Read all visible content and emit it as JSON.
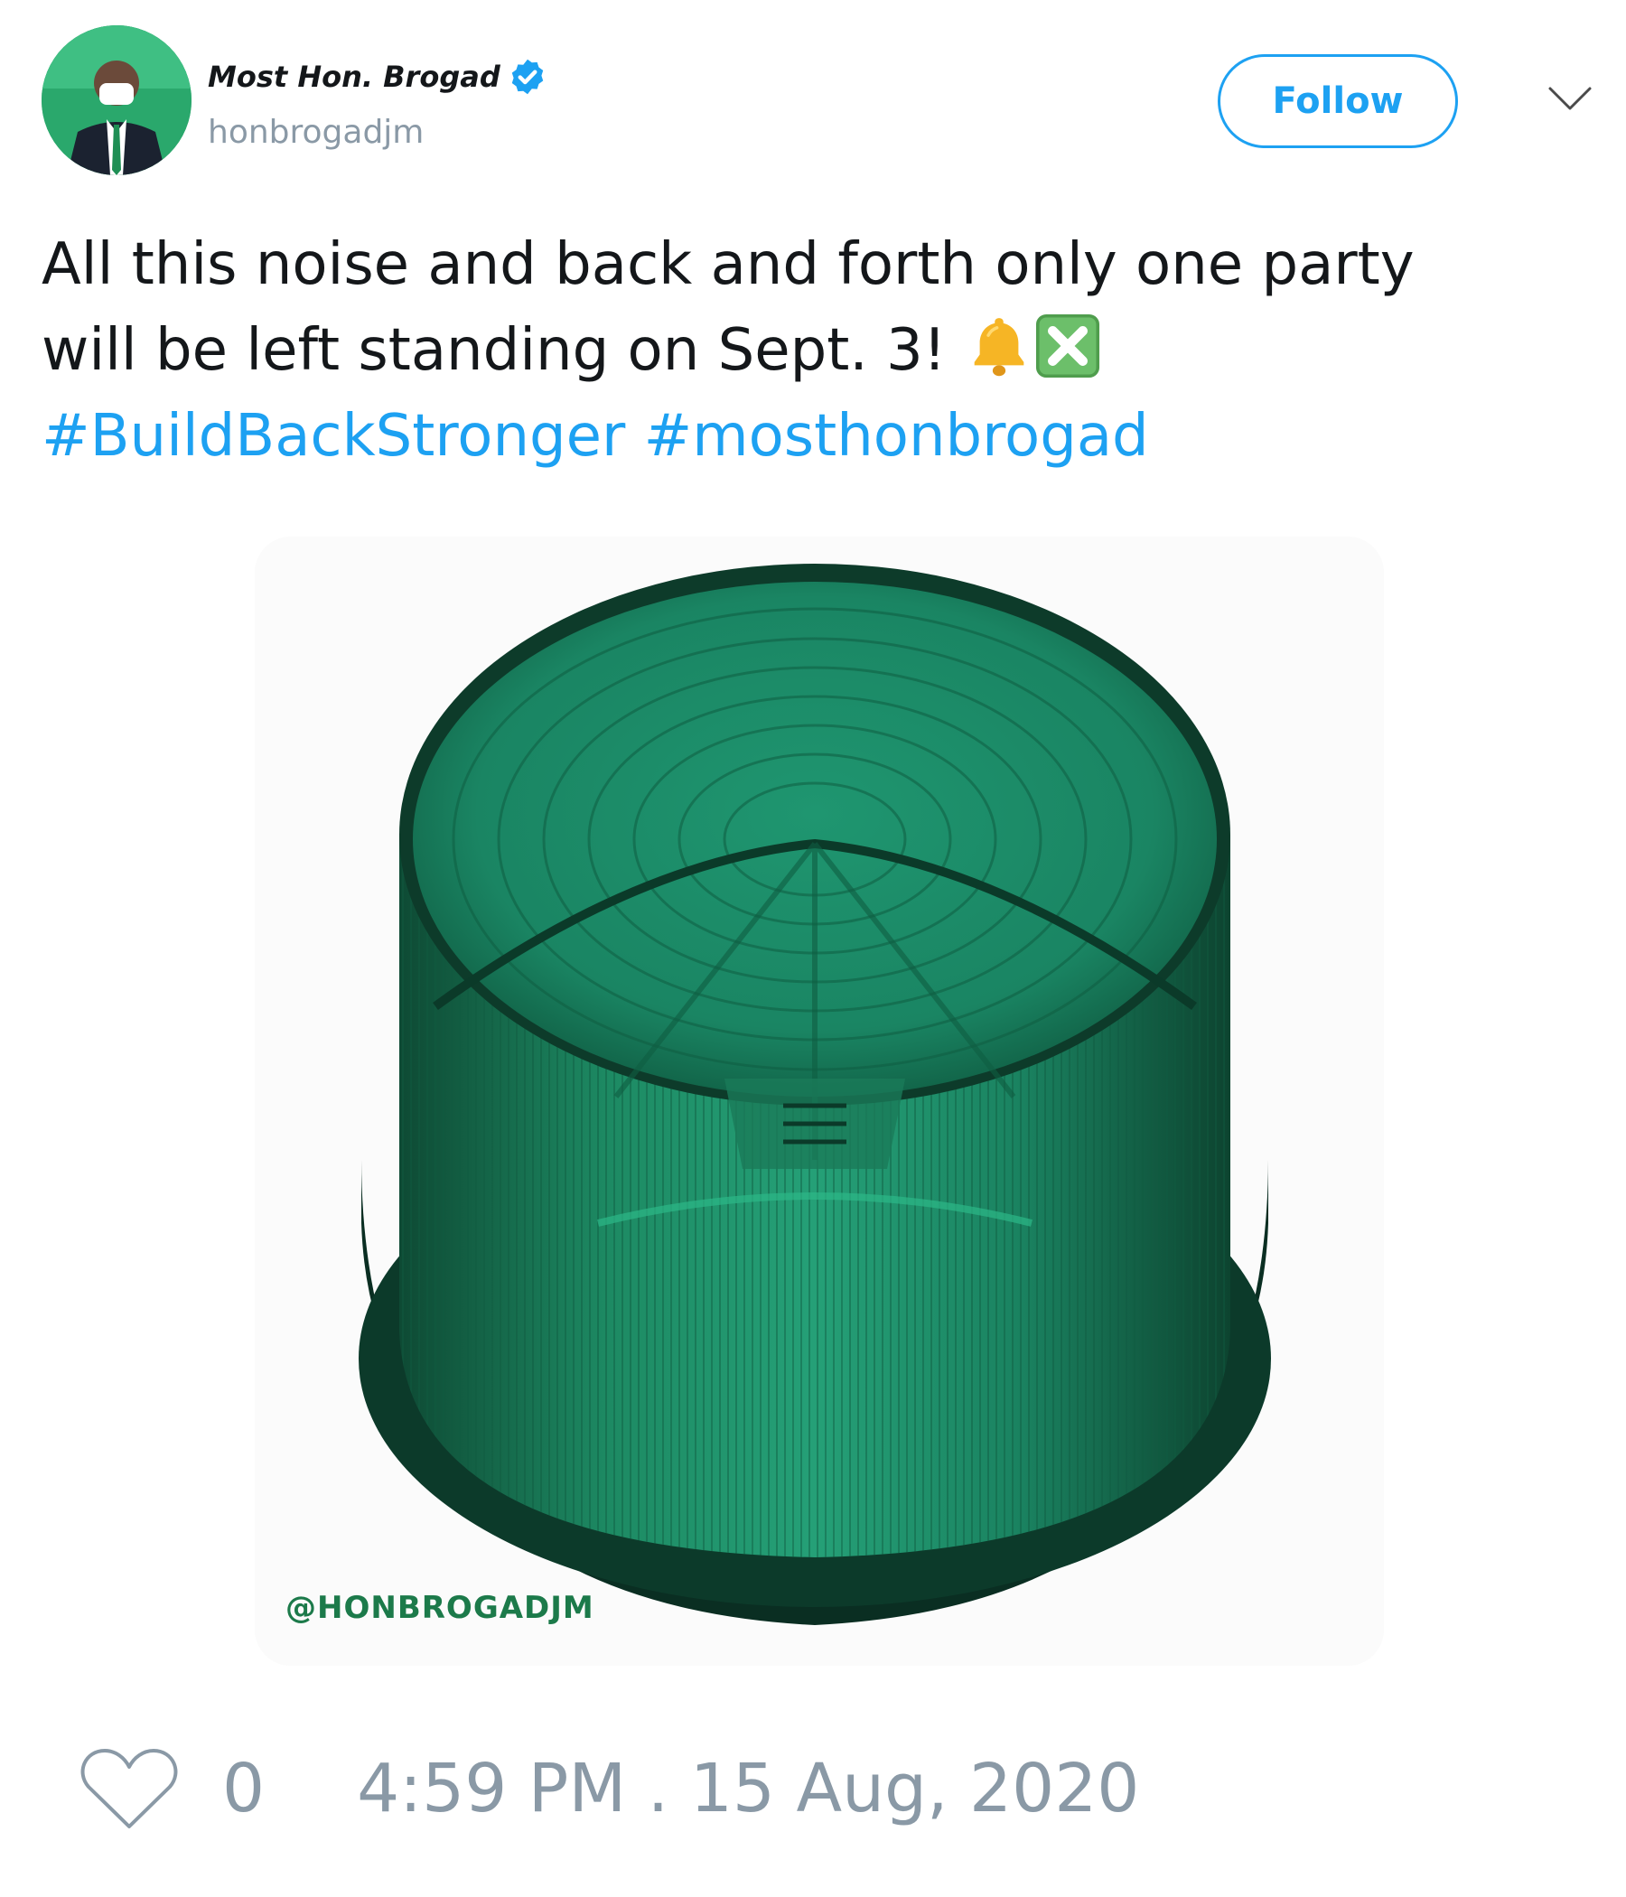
{
  "header": {
    "display_name": "Most Hon. Brogad",
    "handle": "honbrogadjm",
    "verified": true,
    "follow_label": "Follow"
  },
  "tweet": {
    "line1": "All this noise and back and forth only one party",
    "line2": "will be left standing on Sept. 3! ",
    "emojis": [
      "bell-emoji",
      "cross-mark-button-emoji"
    ],
    "hashtags": [
      "#BuildBackStronger",
      "#mosthonbrogad"
    ]
  },
  "media": {
    "watermark": "@HONBROGADJM",
    "subject": "green-strobe-light-cover"
  },
  "footer": {
    "like_count": "0",
    "timestamp": "4:59 PM . 15 Aug, 2020"
  },
  "colors": {
    "accent": "#1da1f2",
    "muted": "#8a99a6",
    "text": "#14171a",
    "brand_green": "#1e9a61"
  }
}
